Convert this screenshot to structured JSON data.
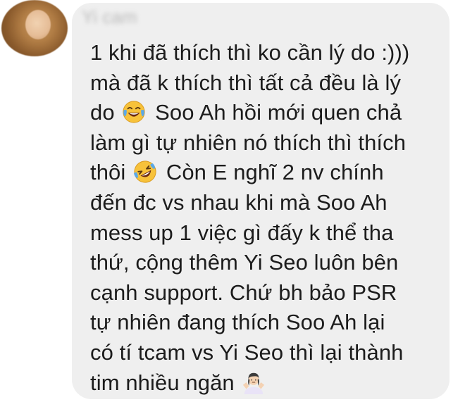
{
  "comment": {
    "author_name": "Yi cam",
    "lines": [
      "1 khi đã thích thì ko cần lý do :)))",
      "mà đã k thích thì tất cả đều là lý",
      "do",
      "Soo Ah hồi mới quen chả",
      "làm gì tự nhiên nó thích thì thích",
      "thôi",
      "Còn E nghĩ 2 nv chính",
      "đến đc vs nhau khi mà Soo Ah",
      "mess up 1 việc gì đấy k thể tha",
      "thứ, cộng thêm Yi Seo luôn bên",
      "cạnh support. Chứ bh bảo PSR",
      "tự nhiên đang thích Soo Ah lại",
      "có tí tcam vs Yi Seo thì lại thành",
      "tim nhiều ngăn"
    ],
    "emojis": [
      "face-with-tears-of-joy",
      "rolling-on-the-floor-laughing",
      "person-shrugging"
    ]
  },
  "colors": {
    "bubble": "#efefef",
    "text": "#1c1c1c",
    "emoji_yellow": "#f7c23a"
  }
}
